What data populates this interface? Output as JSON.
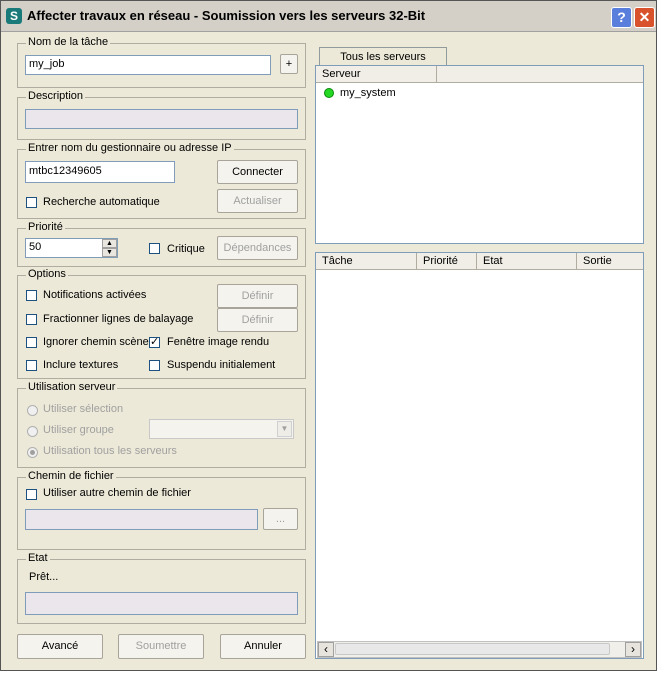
{
  "window": {
    "title": "Affecter travaux en réseau - Soumission vers les serveurs 32-Bit",
    "app_icon_letter": "S",
    "help_glyph": "?",
    "close_glyph": "✕"
  },
  "task": {
    "legend": "Nom de la tâche",
    "value": "my_job",
    "add_label": "+"
  },
  "description": {
    "legend": "Description",
    "value": ""
  },
  "manager": {
    "legend": "Entrer nom du gestionnaire ou adresse IP",
    "value": "mtbc12349605",
    "connect_label": "Connecter",
    "auto_search_label": "Recherche automatique",
    "auto_search_checked": false,
    "refresh_label": "Actualiser"
  },
  "priority": {
    "legend": "Priorité",
    "value": "50",
    "critical_label": "Critique",
    "critical_checked": false,
    "dependencies_label": "Dépendances"
  },
  "options": {
    "legend": "Options",
    "notifications_label": "Notifications activées",
    "split_scanlines_label": "Fractionner lignes de balayage",
    "define_label": "Définir",
    "define2_label": "Définir",
    "ignore_scene_path_label": "Ignorer chemin scène",
    "render_frame_window_label": "Fenêtre image rendu",
    "render_frame_window_checked": true,
    "include_textures_label": "Inclure textures",
    "initially_suspended_label": "Suspendu initialement"
  },
  "server_usage": {
    "legend": "Utilisation serveur",
    "use_selection_label": "Utiliser sélection",
    "use_group_label": "Utiliser groupe",
    "use_all_label": "Utilisation tous les serveurs",
    "selected": "Utilisation tous les serveurs",
    "group_value": ""
  },
  "file_path": {
    "legend": "Chemin de fichier",
    "use_other_label": "Utiliser autre chemin de fichier",
    "value": "",
    "browse_label": "..."
  },
  "status": {
    "legend": "Etat",
    "text": "Prêt...",
    "progress": 0
  },
  "buttons": {
    "advanced": "Avancé",
    "submit": "Soumettre",
    "cancel": "Annuler"
  },
  "servers": {
    "tab_label": "Tous les serveurs",
    "columns": [
      "Serveur",
      ""
    ],
    "rows": [
      {
        "name": "my_system",
        "status_color": "#24d824"
      }
    ]
  },
  "jobs": {
    "columns": [
      "Tâche",
      "Priorité",
      "Etat",
      "Sortie"
    ],
    "rows": []
  },
  "scroll": {
    "left_glyph": "‹",
    "right_glyph": "›"
  }
}
